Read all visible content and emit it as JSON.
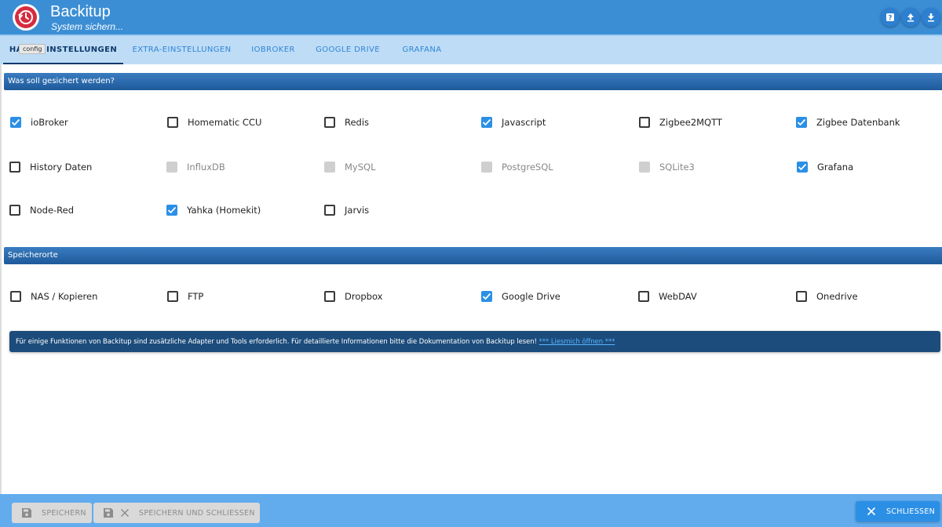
{
  "app": {
    "title": "Backitup",
    "subtitle": "System sichern..."
  },
  "header_buttons": [
    {
      "icon": "help-icon"
    },
    {
      "icon": "upload-icon"
    },
    {
      "icon": "download-icon"
    }
  ],
  "tabs": [
    {
      "label": "HAUPTEINSTELLUNGEN",
      "active": true
    },
    {
      "label": "EXTRA-EINSTELLUNGEN",
      "active": false
    },
    {
      "label": "IOBROKER",
      "active": false
    },
    {
      "label": "GOOGLE DRIVE",
      "active": false
    },
    {
      "label": "GRAFANA",
      "active": false
    }
  ],
  "tooltip": "config",
  "sections": {
    "backup": "Was soll gesichert werden?",
    "storage": "Speicherorte"
  },
  "backup_items": [
    {
      "label": "ioBroker",
      "state": "checked"
    },
    {
      "label": "Homematic CCU",
      "state": "unchecked"
    },
    {
      "label": "Redis",
      "state": "unchecked"
    },
    {
      "label": "Javascript",
      "state": "checked"
    },
    {
      "label": "Zigbee2MQTT",
      "state": "unchecked"
    },
    {
      "label": "Zigbee Datenbank",
      "state": "checked"
    },
    {
      "label": "History Daten",
      "state": "unchecked"
    },
    {
      "label": "InfluxDB",
      "state": "disabled"
    },
    {
      "label": "MySQL",
      "state": "disabled"
    },
    {
      "label": "PostgreSQL",
      "state": "disabled"
    },
    {
      "label": "SQLite3",
      "state": "disabled"
    },
    {
      "label": "Grafana",
      "state": "checked"
    },
    {
      "label": "Node-Red",
      "state": "unchecked"
    },
    {
      "label": "Yahka (Homekit)",
      "state": "checked"
    },
    {
      "label": "Jarvis",
      "state": "unchecked"
    }
  ],
  "storage_items": [
    {
      "label": "NAS / Kopieren",
      "state": "unchecked"
    },
    {
      "label": "FTP",
      "state": "unchecked"
    },
    {
      "label": "Dropbox",
      "state": "unchecked"
    },
    {
      "label": "Google Drive",
      "state": "checked"
    },
    {
      "label": "WebDAV",
      "state": "unchecked"
    },
    {
      "label": "Onedrive",
      "state": "unchecked"
    }
  ],
  "info": {
    "text": "Für einige Funktionen von Backitup sind zusätzliche Adapter und Tools erforderlich. Für detaillierte Informationen bitte die Dokumentation von Backitup lesen!",
    "link": "*** Liesmich öffnen ***"
  },
  "footer": {
    "save": "SPEICHERN",
    "save_close": "SPEICHERN UND SCHLIESSEN",
    "close": "SCHLIESSEN"
  },
  "colors": {
    "header": "#3c8ed4",
    "tabbar": "#bfdcf6",
    "section": "#1e5a9a",
    "checkbox_checked": "#2b8fe6",
    "info_bar": "#1c4c7c",
    "footer": "#62acee"
  }
}
